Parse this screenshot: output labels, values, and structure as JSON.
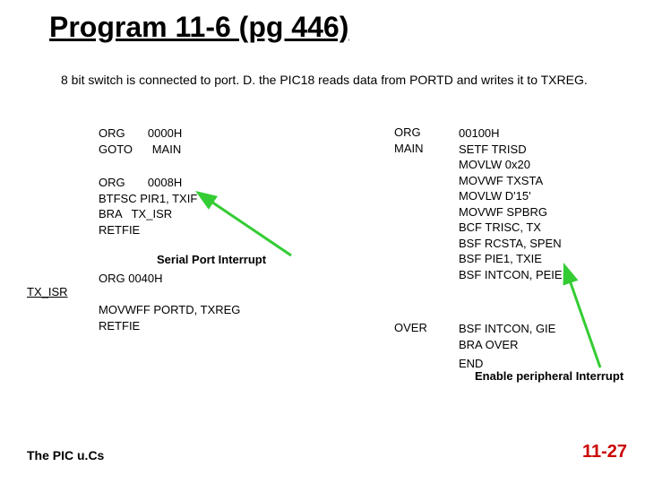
{
  "title": "Program 11-6 (pg 446)",
  "description": "8 bit switch is connected to port. D. the PIC18 reads data from PORTD and writes it to TXREG.",
  "code_block_a": "ORG       0000H\nGOTO      MAIN",
  "code_block_b": "ORG       0008H\nBTFSC PIR1, TXIF\nBRA   TX_ISR\nRETFIE",
  "caption_serial": "Serial Port Interrupt",
  "code_block_c": "ORG 0040H\n\nMOVWFF PORTD, TXREG\nRETFIE",
  "tx_isr_label": "TX_ISR",
  "org_right_label": "ORG",
  "main_right_label": "MAIN",
  "code_block_d": "00100H\nSETF TRISD\nMOVLW 0x20\nMOVWF TXSTA\nMOVLW D'15'\nMOVWF SPBRG\nBCF TRISC, TX\nBSF RCSTA, SPEN\nBSF PIE1, TXIE\nBSF INTCON, PEIE",
  "over_label": "OVER",
  "code_block_e": "BSF INTCON, GIE\nBRA OVER",
  "end_label": "END",
  "caption_peripheral": "Enable peripheral Interrupt",
  "footer_left": "The PIC u.Cs",
  "footer_right": "11-27",
  "arrow_color": "#33cc33"
}
